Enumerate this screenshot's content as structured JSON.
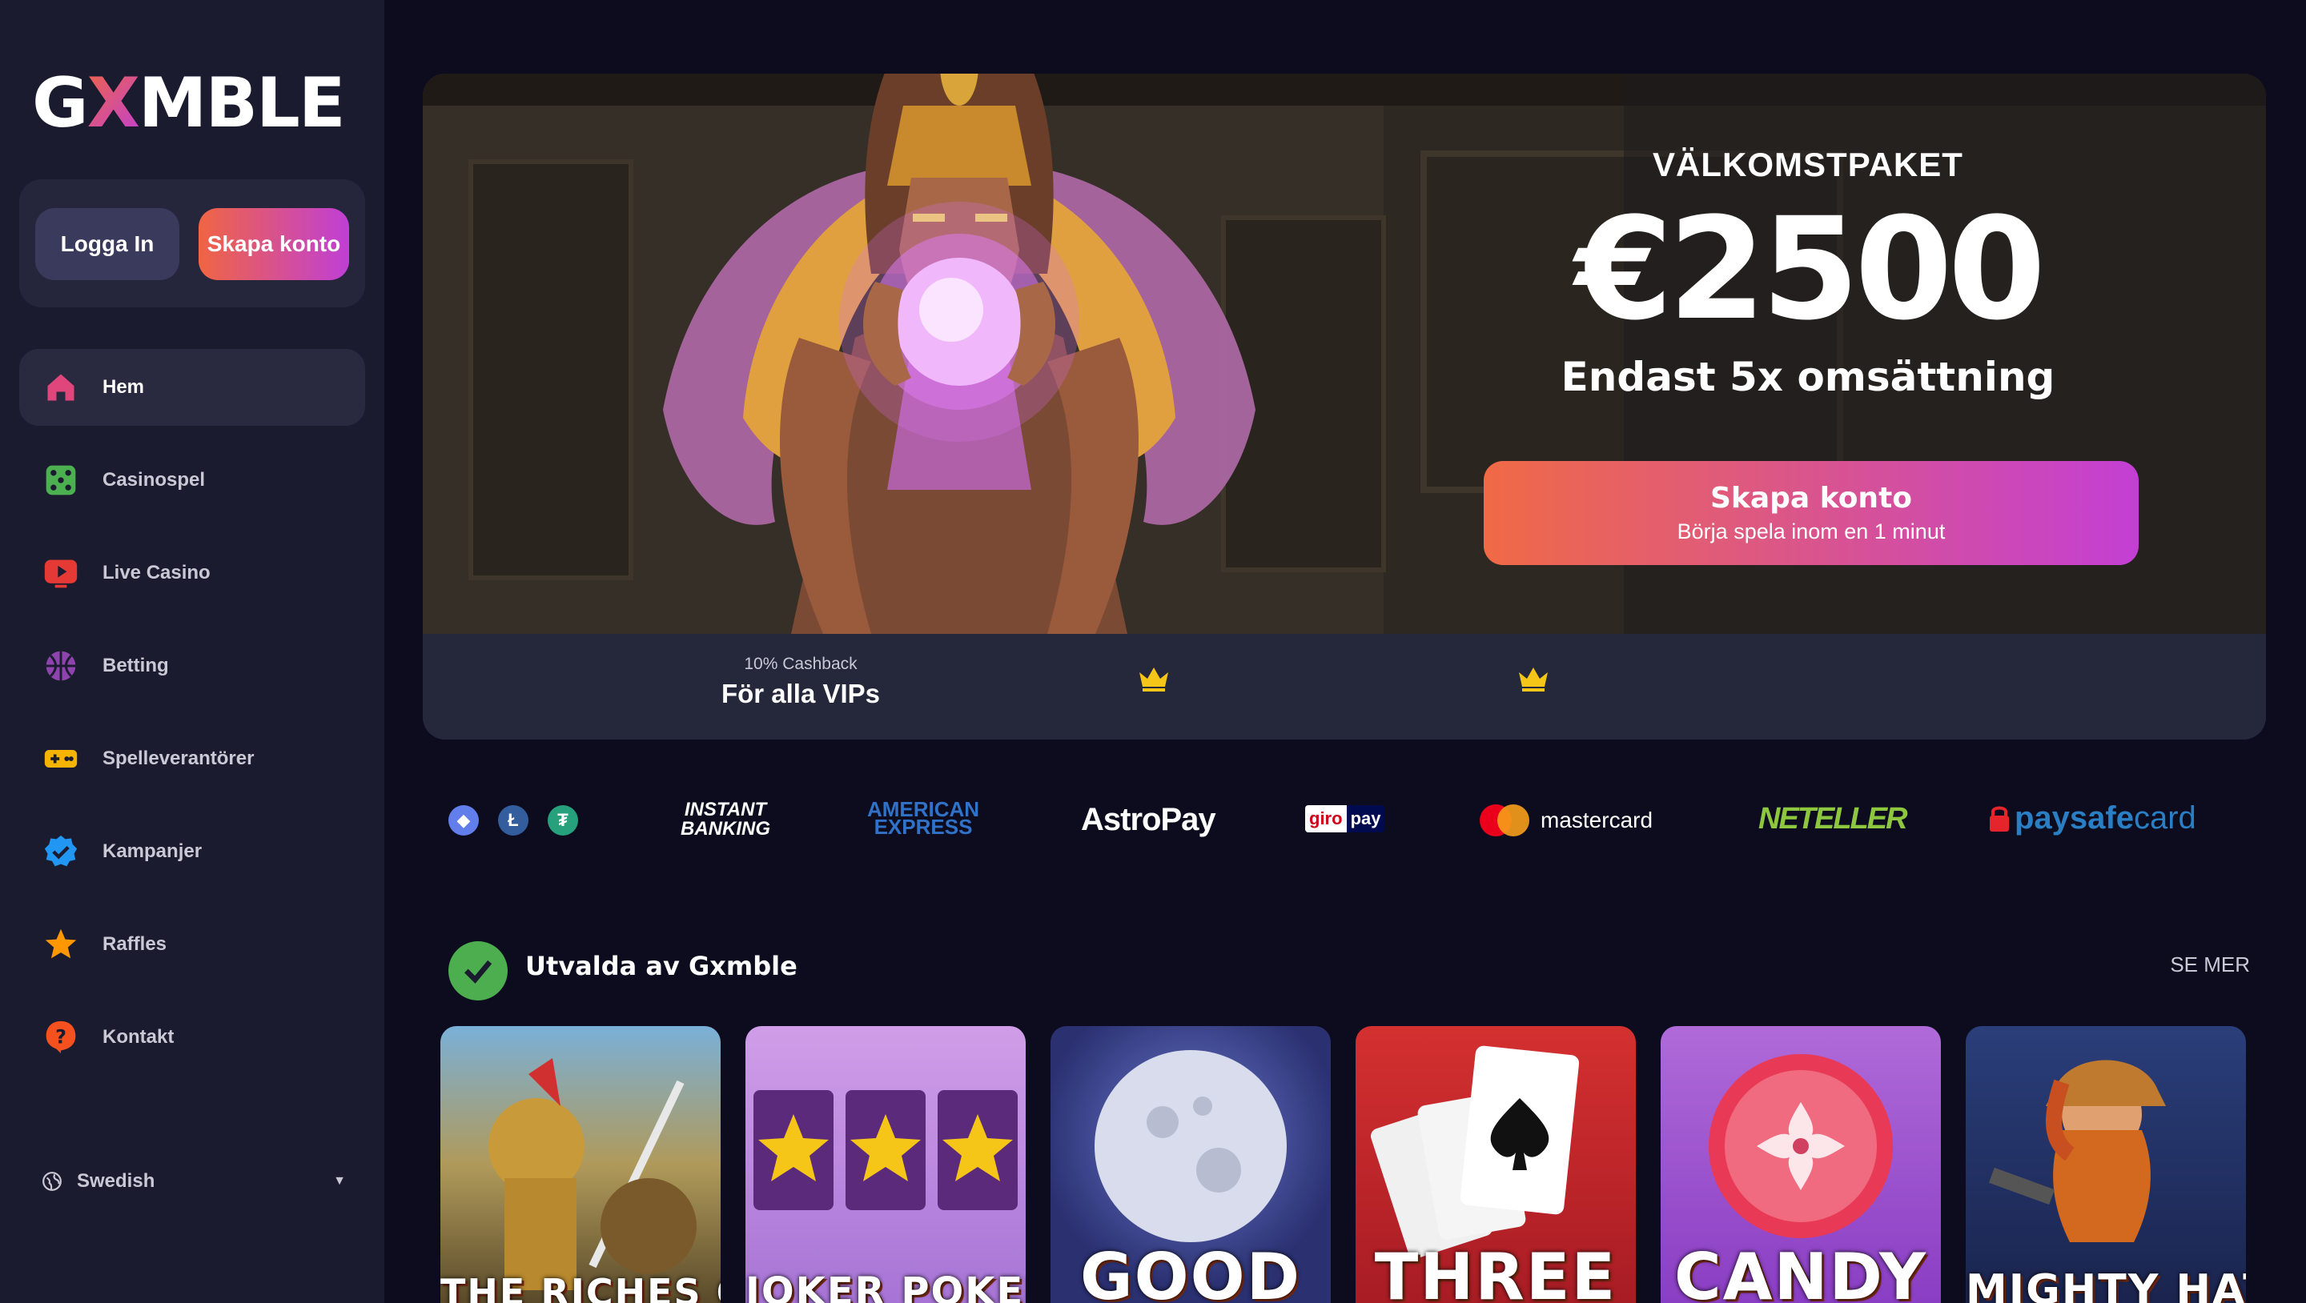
{
  "brand": {
    "logo_pre": "G",
    "logo_x": "X",
    "logo_post": "MBLE"
  },
  "auth": {
    "login_label": "Logga In",
    "signup_label": "Skapa konto"
  },
  "nav": {
    "items": [
      {
        "label": "Hem",
        "icon": "home-icon",
        "color": "#e0457b",
        "active": true
      },
      {
        "label": "Casinospel",
        "icon": "dice-icon",
        "color": "#4caf50"
      },
      {
        "label": "Live Casino",
        "icon": "play-icon",
        "color": "#e53935"
      },
      {
        "label": "Betting",
        "icon": "basketball-icon",
        "color": "#8e44ad"
      },
      {
        "label": "Spelleverantörer",
        "icon": "gamepad-icon",
        "color": "#f4b400"
      },
      {
        "label": "Kampanjer",
        "icon": "badge-check-icon",
        "color": "#2196f3"
      },
      {
        "label": "Raffles",
        "icon": "star-icon",
        "color": "#ff9800"
      },
      {
        "label": "Kontakt",
        "icon": "help-icon",
        "color": "#f4511e"
      }
    ]
  },
  "language": {
    "selected": "Swedish"
  },
  "hero": {
    "title": "VÄLKOMSTPAKET",
    "amount": "€2500",
    "subtitle": "Endast 5x omsättning",
    "cta_main": "Skapa konto",
    "cta_sub": "Börja spela inom en 1 minut",
    "vip_small": "10% Cashback",
    "vip_big": "För alla VIPs"
  },
  "payments": {
    "instant_banking_1": "INSTANT",
    "instant_banking_2": "BANKING",
    "amex_1": "AMERICAN",
    "amex_2": "EXPRESS",
    "astropay": "AstroPay",
    "giro": "giro",
    "giro_pay": "pay",
    "mastercard": "mastercard",
    "neteller": "NETELLER",
    "paysafe_1": "paysafe",
    "paysafe_2": "card"
  },
  "featured": {
    "title": "Utvalda av Gxmble",
    "see_more": "SE MER",
    "games": [
      {
        "title": "THE RICHES OF",
        "bg": "#8a6a3a"
      },
      {
        "title": "JOKER POKER",
        "bg": "#b57ad9"
      },
      {
        "title": "GOOD",
        "bg": "#2c3e7a"
      },
      {
        "title": "THREE",
        "bg": "#c0262e"
      },
      {
        "title": "CANDY",
        "bg": "#a855d9"
      },
      {
        "title": "MIGHTY HAT",
        "bg": "#1e2a5a"
      }
    ]
  }
}
